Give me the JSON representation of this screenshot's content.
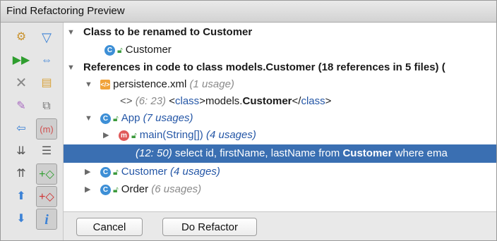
{
  "window": {
    "title": "Find Refactoring Preview"
  },
  "toolbar": {
    "col1": [
      "preview-settings-icon",
      "rerun-icon",
      "close-icon",
      "pin-icon",
      "previous-occurrence-icon",
      "expand-all-icon",
      "collapse-all-icon",
      "scroll-up-icon",
      "scroll-down-icon"
    ],
    "col2": [
      "filter-icon",
      "autoscroll-icon",
      "group-by-file-icon",
      "group-by-package-icon",
      "group-by-method-icon",
      "merge-icon",
      "exclude-icon",
      "remove-icon",
      "info-icon"
    ]
  },
  "tree": {
    "group1": {
      "label": "Class to be renamed to Customer"
    },
    "class_item": {
      "icon": "C",
      "name": "Customer"
    },
    "group2": {
      "label": "References in code to class models.Customer (18 references in 5 files) ("
    },
    "file1": {
      "name": "persistence.xml",
      "usage": "(1 usage)"
    },
    "xml_line": {
      "pos": "(6: 23)",
      "open_lt": "<",
      "open_tag": "class",
      "open_gt": ">",
      "prefix": "models.",
      "match": "Customer",
      "close_lt": "</",
      "close_tag": "class",
      "close_gt": ">"
    },
    "app": {
      "icon": "C",
      "name": "App",
      "usage": "(7 usages)"
    },
    "main": {
      "icon": "m",
      "name": "main(String[])",
      "usage": "(4 usages)"
    },
    "selected_line": {
      "pos": "(12: 50)",
      "before": "select id, firstName, lastName from",
      "match": "Customer",
      "after": "where ema"
    },
    "customer": {
      "icon": "C",
      "name": "Customer",
      "usage": "(4 usages)"
    },
    "order": {
      "icon": "C",
      "name": "Order",
      "usage": "(6 usages)"
    }
  },
  "buttons": {
    "cancel": "Cancel",
    "do_refactor": "Do Refactor"
  }
}
